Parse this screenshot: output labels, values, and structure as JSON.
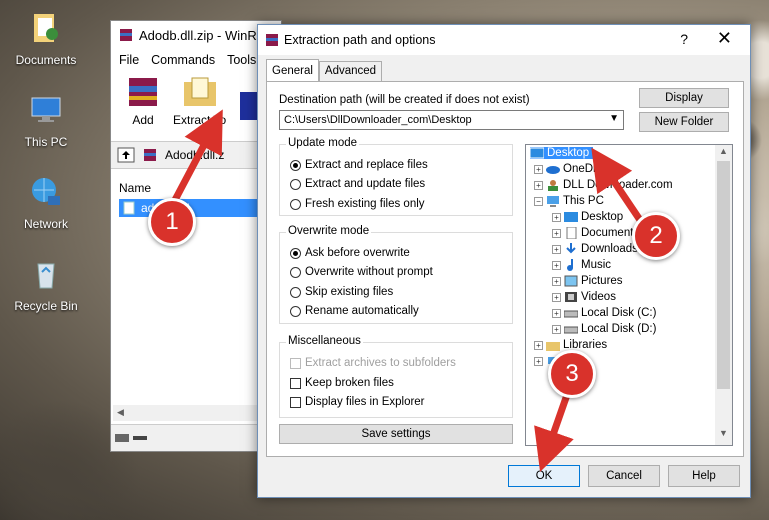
{
  "desktop": {
    "icons": [
      {
        "label": "Documents",
        "icon": "documents-folder-icon"
      },
      {
        "label": "This PC",
        "icon": "computer-icon"
      },
      {
        "label": "Network",
        "icon": "network-globe-icon"
      },
      {
        "label": "Recycle Bin",
        "icon": "recycle-bin-icon"
      }
    ]
  },
  "winrar": {
    "title": "Adodb.dll.zip - WinR",
    "menu": [
      "File",
      "Commands",
      "Tools"
    ],
    "toolbar": {
      "add": "Add",
      "extract_to": "Extract To"
    },
    "address": "Adodb.dll.z",
    "column_name": "Name",
    "selected_file": "adodb.dll"
  },
  "dialog": {
    "title": "Extraction path and options",
    "help": "?",
    "close": "✕",
    "tabs": [
      "General",
      "Advanced"
    ],
    "destination_label": "Destination path (will be created if does not exist)",
    "destination_value": "C:\\Users\\DllDownloader_com\\Desktop",
    "display_button": "Display",
    "new_folder_button": "New Folder",
    "update_mode": {
      "title": "Update mode",
      "options": [
        "Extract and replace files",
        "Extract and update files",
        "Fresh existing files only"
      ],
      "selected": 0
    },
    "overwrite_mode": {
      "title": "Overwrite mode",
      "options": [
        "Ask before overwrite",
        "Overwrite without prompt",
        "Skip existing files",
        "Rename automatically"
      ],
      "selected": 0
    },
    "misc": {
      "title": "Miscellaneous",
      "options": [
        "Extract archives to subfolders",
        "Keep broken files",
        "Display files in Explorer"
      ]
    },
    "save_settings": "Save settings",
    "tree": [
      "Desktop",
      "OneDrive",
      "DLL Downloader.com",
      "This PC",
      "Desktop",
      "Documents",
      "Downloads",
      "Music",
      "Pictures",
      "Videos",
      "Local Disk (C:)",
      "Local Disk (D:)",
      "Libraries",
      "Network"
    ],
    "tree_visible": [
      "Desktop",
      "OneDr",
      "DLL Downloader.com",
      "This PC",
      "Desktop",
      "Documents",
      "Downloads",
      "Music",
      "Pictures",
      "Videos",
      "Local Disk (C:)",
      "Local Disk (D:)",
      "Libraries",
      "work"
    ],
    "ok": "OK",
    "cancel": "Cancel",
    "help_button": "Help"
  },
  "annotations": {
    "steps": [
      "1",
      "2",
      "3"
    ],
    "color": "#d9322b"
  }
}
